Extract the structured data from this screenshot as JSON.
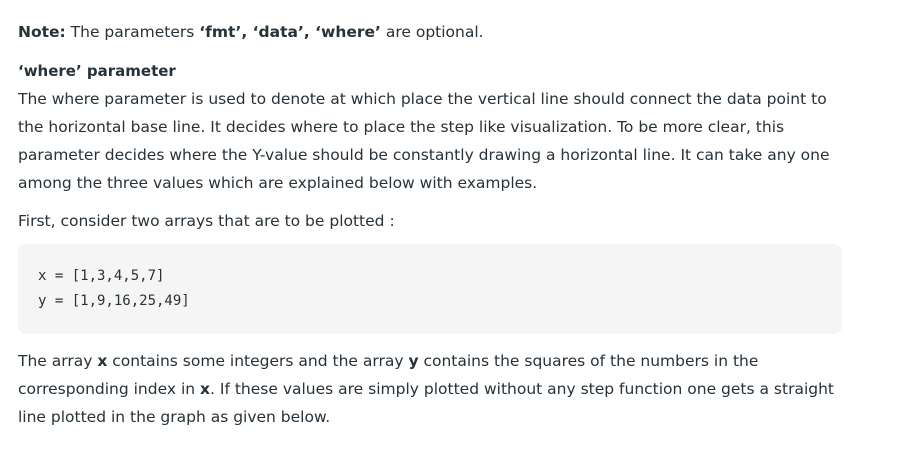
{
  "note": {
    "label": "Note:",
    "text_before": " The parameters ",
    "params": "‘fmt’, ‘data’, ‘where’",
    "text_after": "  are optional."
  },
  "where_section": {
    "heading": "‘where’ parameter",
    "paragraph": "The where parameter is used to denote at which place the vertical line should connect the data point to the horizontal base line. It decides where to place the step like visualization. To be more clear, this parameter decides where the Y-value should be constantly drawing a horizontal line. It can take any one among the three values which are explained below with examples."
  },
  "intro": "First, consider two arrays that are to be plotted :",
  "code": {
    "lines": [
      "x = [1,3,4,5,7]",
      "y = [1,9,16,25,49]"
    ]
  },
  "explanation": {
    "part1": "The array ",
    "x1": "x",
    "part2": " contains some integers and the array ",
    "y": "y",
    "part3": " contains the squares of the numbers in the corresponding index in ",
    "x2": "x",
    "part4": ". If these values are simply plotted without any step function one gets a straight line plotted in the graph as given below."
  }
}
